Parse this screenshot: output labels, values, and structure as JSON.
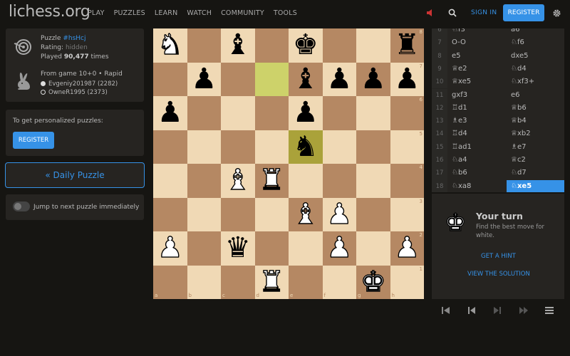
{
  "header": {
    "logo": "lichess",
    "logo_tld": ".org",
    "nav": [
      "PLAY",
      "PUZZLES",
      "LEARN",
      "WATCH",
      "COMMUNITY",
      "TOOLS"
    ],
    "sign_in": "SIGN IN",
    "register": "REGISTER"
  },
  "puzzle": {
    "label": "Puzzle",
    "id": "#hsHcj",
    "rating_label": "Rating:",
    "rating_value": "hidden",
    "played_prefix": "Played",
    "played_count": "90,477",
    "played_suffix": "times",
    "game_prefix": "From game",
    "game_mode": "10+0 • Rapid",
    "white_player": "Evgeniy201987 (2282)",
    "black_player": "OwneR1995 (2373)"
  },
  "personalize": {
    "text": "To get personalized puzzles:",
    "button": "REGISTER"
  },
  "daily": "« Daily Puzzle",
  "jump": {
    "label": "Jump to next puzzle immediately",
    "enabled": false
  },
  "board": {
    "orientation": "white",
    "ranks": [
      "8",
      "7",
      "6",
      "5",
      "4",
      "3",
      "2",
      "1"
    ],
    "files": [
      "a",
      "b",
      "c",
      "d",
      "e",
      "f",
      "g",
      "h"
    ],
    "highlight": [
      "d7",
      "e5"
    ],
    "pieces": {
      "a8": "wN",
      "c8": "bB",
      "e8": "bK",
      "h8": "bR",
      "b7": "bP",
      "e7": "bB",
      "f7": "bP",
      "g7": "bP",
      "h7": "bP",
      "a6": "bP",
      "e6": "bP",
      "e5": "bN",
      "c4": "wB",
      "d4": "wR",
      "e3": "wB",
      "f3": "wP",
      "a2": "wP",
      "c2": "bQ",
      "f2": "wP",
      "h2": "wP",
      "d1": "wR",
      "g1": "wK"
    }
  },
  "moves": [
    {
      "n": "6",
      "w": "♘f3",
      "b": "a6"
    },
    {
      "n": "7",
      "w": "O-O",
      "b": "♘f6"
    },
    {
      "n": "8",
      "w": "e5",
      "b": "dxe5"
    },
    {
      "n": "9",
      "w": "♕e2",
      "b": "♘d4"
    },
    {
      "n": "10",
      "w": "♕xe5",
      "b": "♘xf3+"
    },
    {
      "n": "11",
      "w": "gxf3",
      "b": "e6"
    },
    {
      "n": "12",
      "w": "♖d1",
      "b": "♕b6"
    },
    {
      "n": "13",
      "w": "♗e3",
      "b": "♕b4"
    },
    {
      "n": "14",
      "w": "♖d4",
      "b": "♕xb2"
    },
    {
      "n": "15",
      "w": "♖ad1",
      "b": "♗e7"
    },
    {
      "n": "16",
      "w": "♘a4",
      "b": "♕c2"
    },
    {
      "n": "17",
      "w": "♘b6",
      "b": "♘d7"
    },
    {
      "n": "18",
      "w": "♘xa8",
      "b": "♘xe5"
    }
  ],
  "active_move": "18b",
  "turn": {
    "title": "Your turn",
    "subtitle": "Find the best move for white.",
    "hint": "GET A HINT",
    "solution": "VIEW THE SOLUTION"
  },
  "colors": {
    "accent": "#3692e7",
    "bg": "#161512",
    "panel": "#262421",
    "light_square": "#f0d9b5",
    "dark_square": "#b58863"
  },
  "icons": [
    "sound-muted-icon",
    "search-icon",
    "gear-icon",
    "target-icon",
    "rabbit-icon",
    "white-king-icon",
    "first-move-icon",
    "prev-move-icon",
    "next-move-icon",
    "last-move-icon",
    "menu-icon"
  ]
}
